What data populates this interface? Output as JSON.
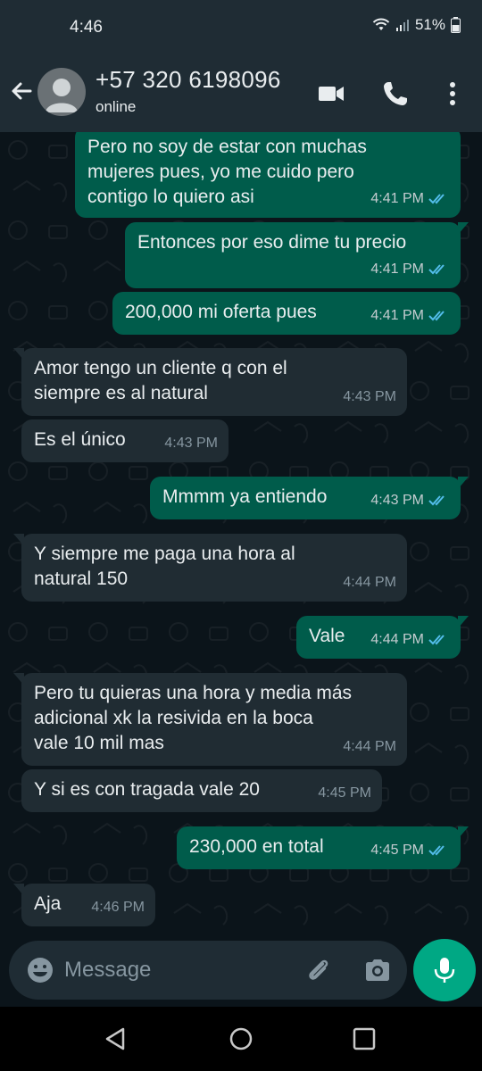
{
  "status_bar": {
    "time": "4:46",
    "battery": "51%"
  },
  "header": {
    "contact_name": "+57 320 6198096",
    "status": "online"
  },
  "messages": [
    {
      "dir": "out",
      "text": "Pero no soy de estar con muchas\nmujeres pues, yo me cuido pero\ncontigo lo quiero asi",
      "time": "4:41 PM",
      "read": true
    },
    {
      "dir": "out",
      "text": "Entonces por eso dime tu precio",
      "time": "4:41 PM",
      "read": true
    },
    {
      "dir": "out",
      "text": "200,000 mi oferta pues",
      "time": "4:41 PM",
      "read": true
    },
    {
      "dir": "in",
      "text": "Amor tengo un cliente q con el\nsiempre es al natural",
      "time": "4:43 PM"
    },
    {
      "dir": "in",
      "text": "Es el único",
      "time": "4:43 PM"
    },
    {
      "dir": "out",
      "text": "Mmmm ya entiendo",
      "time": "4:43 PM",
      "read": true
    },
    {
      "dir": "in",
      "text": "Y siempre me paga una hora al\nnatural 150",
      "time": "4:44 PM"
    },
    {
      "dir": "out",
      "text": "Vale",
      "time": "4:44 PM",
      "read": true
    },
    {
      "dir": "in",
      "text": "Pero tu quieras una hora y media más\nadicional xk la resivida en la boca\nvale 10 mil mas",
      "time": "4:44 PM"
    },
    {
      "dir": "in",
      "text": "Y si es con tragada vale 20",
      "time": "4:45 PM"
    },
    {
      "dir": "out",
      "text": "230,000 en total",
      "time": "4:45 PM",
      "read": true
    },
    {
      "dir": "in",
      "text": "Aja",
      "time": "4:46 PM"
    }
  ],
  "composer": {
    "placeholder": "Message"
  },
  "icons": {
    "back": "arrow-left-icon",
    "video": "video-call-icon",
    "call": "phone-icon",
    "menu": "more-vert-icon",
    "emoji": "emoji-icon",
    "attach": "paperclip-icon",
    "camera": "camera-icon",
    "mic": "microphone-icon"
  },
  "colors": {
    "header_bg": "#1f2c34",
    "chat_bg": "#0b141a",
    "outgoing_bubble": "#005c4b",
    "incoming_bubble": "#202c33",
    "accent": "#00a884",
    "read_ticks": "#53bdeb"
  }
}
